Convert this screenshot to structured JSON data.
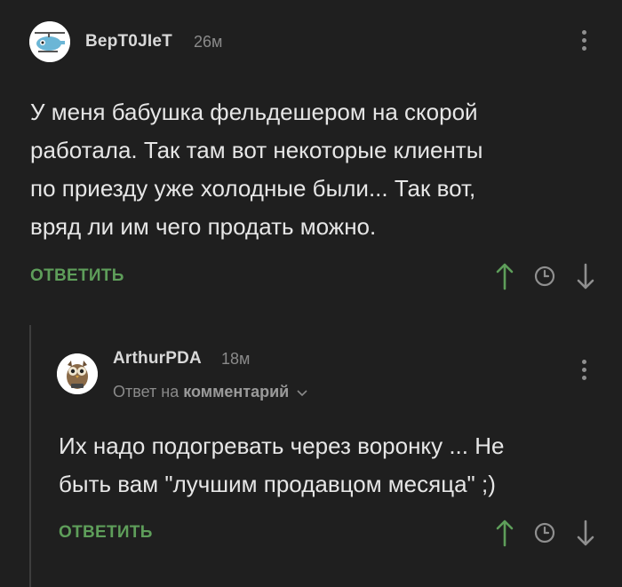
{
  "comments": [
    {
      "username": "ВерТ0JIеТ",
      "time": "26м",
      "text_lines": [
        "У меня бабушка фельдешером на скорой",
        "работала. Так там вот некоторые клиенты",
        "по приезду уже холодные были... Так вот,",
        "вряд ли им чего продать можно."
      ],
      "reply_label": "ОТВЕТИТЬ"
    },
    {
      "username": "ArthurPDA",
      "time": "18м",
      "reply_to_prefix": "Ответ на",
      "reply_to_target": "комментарий",
      "text_lines": [
        "Их надо подогревать через воронку ... Не",
        "быть вам \"лучшим продавцом месяца\" ;)"
      ],
      "reply_label": "ОТВЕТИТЬ"
    }
  ],
  "colors": {
    "background": "#1f1f1f",
    "accent_green": "#5e9e5a",
    "muted": "#8a8a8a"
  },
  "icons": [
    "more-vertical-icon",
    "arrow-up-icon",
    "clock-icon",
    "arrow-down-icon",
    "chevron-down-icon"
  ]
}
